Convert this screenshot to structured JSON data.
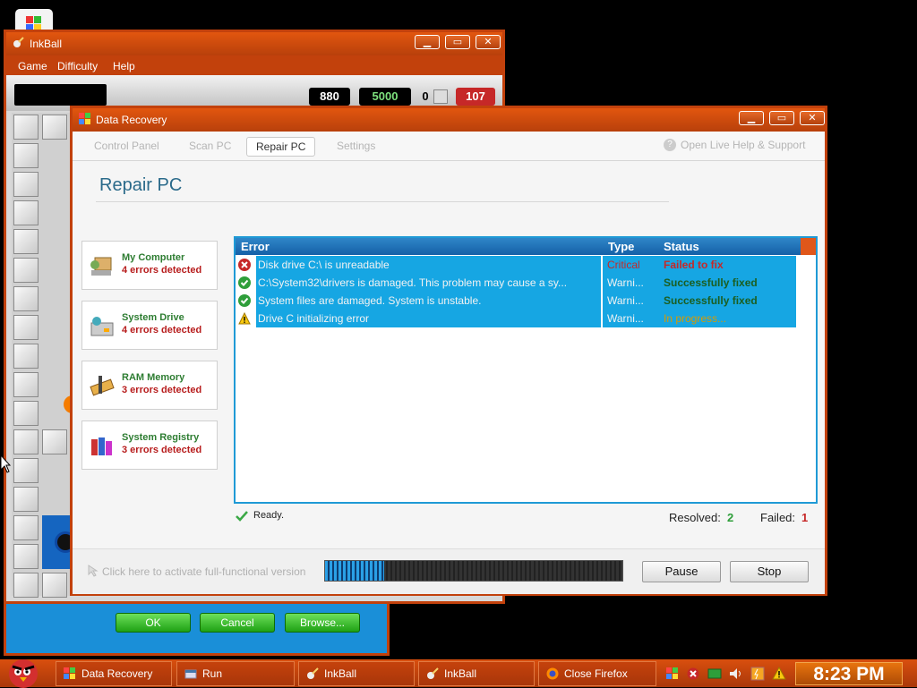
{
  "taskbar": {
    "items": [
      {
        "label": "Data Recovery"
      },
      {
        "label": "Run"
      },
      {
        "label": "InkBall"
      },
      {
        "label": "InkBall"
      },
      {
        "label": "Close Firefox"
      }
    ],
    "clock": "8:23 PM"
  },
  "inkball": {
    "title": "InkBall",
    "menu": [
      "Game",
      "Difficulty",
      "Help"
    ],
    "scores": {
      "score1": "880",
      "score2": "5000",
      "balls": "0",
      "timer": "107"
    }
  },
  "run_dialog": {
    "buttons": [
      "OK",
      "Cancel",
      "Browse..."
    ]
  },
  "data_recovery": {
    "title": "Data Recovery",
    "nav": [
      "Control Panel",
      "Scan PC",
      "Repair PC",
      "Settings"
    ],
    "active_tab": "Repair PC",
    "help_link": "Open Live Help & Support",
    "page_title": "Repair PC",
    "cards": [
      {
        "name": "My Computer",
        "errors": "4 errors detected"
      },
      {
        "name": "System Drive",
        "errors": "4 errors detected"
      },
      {
        "name": "RAM Memory",
        "errors": "3 errors detected"
      },
      {
        "name": "System Registry",
        "errors": "3 errors detected"
      }
    ],
    "table": {
      "headers": [
        "Error",
        "Type",
        "Status"
      ],
      "rows": [
        {
          "icon": "error-x-icon",
          "error": "Disk drive C:\\ is unreadable",
          "type": "Critical",
          "status": "Failed to fix"
        },
        {
          "icon": "check-icon",
          "error": "C:\\System32\\drivers is damaged. This problem may cause a sy...",
          "type": "Warni...",
          "status": "Successfully fixed"
        },
        {
          "icon": "check-icon",
          "error": "System files are damaged. System is unstable.",
          "type": "Warni...",
          "status": "Successfully fixed"
        },
        {
          "icon": "warning-icon",
          "error": "Drive C initializing error",
          "type": "Warni...",
          "status": "In progress..."
        }
      ]
    },
    "status_text": "Ready.",
    "resolved_label": "Resolved:",
    "resolved_value": "2",
    "failed_label": "Failed:",
    "failed_value": "1",
    "activate_text": "Click here to activate full-functional version",
    "progress": 0.2,
    "buttons": {
      "pause": "Pause",
      "stop": "Stop"
    }
  },
  "colors": {
    "accent": "#c2410c",
    "row_bg": "#16a6e3",
    "ok": "#2e7d32",
    "fail": "#c62828"
  }
}
